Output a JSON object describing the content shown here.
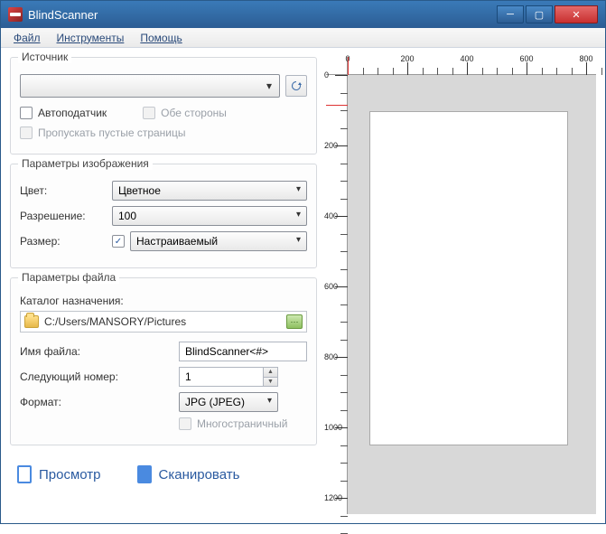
{
  "window": {
    "title": "BlindScanner"
  },
  "menu": {
    "file": "Файл",
    "tools": "Инструменты",
    "help": "Помощь"
  },
  "source": {
    "group_title": "Источник",
    "autofeeder": "Автоподатчик",
    "duplex": "Обе стороны",
    "skip_blank": "Пропускать пустые страницы"
  },
  "image": {
    "group_title": "Параметры изображения",
    "color_label": "Цвет:",
    "color_value": "Цветное",
    "resolution_label": "Разрешение:",
    "resolution_value": "100",
    "size_label": "Размер:",
    "size_value": "Настраиваемый"
  },
  "file": {
    "group_title": "Параметры файла",
    "dest_label": "Каталог назначения:",
    "dest_path": "C:/Users/MANSORY/Pictures",
    "name_label": "Имя файла:",
    "name_value": "BlindScanner<#>",
    "next_label": "Следующий номер:",
    "next_value": "1",
    "format_label": "Формат:",
    "format_value": "JPG (JPEG)",
    "multipage": "Многостраничный"
  },
  "actions": {
    "preview": "Просмотр",
    "scan": "Сканировать"
  },
  "ruler": {
    "h_ticks": [
      0,
      200,
      400,
      600,
      800
    ],
    "v_ticks": [
      0,
      200,
      400,
      600,
      800,
      1000,
      1200
    ]
  }
}
